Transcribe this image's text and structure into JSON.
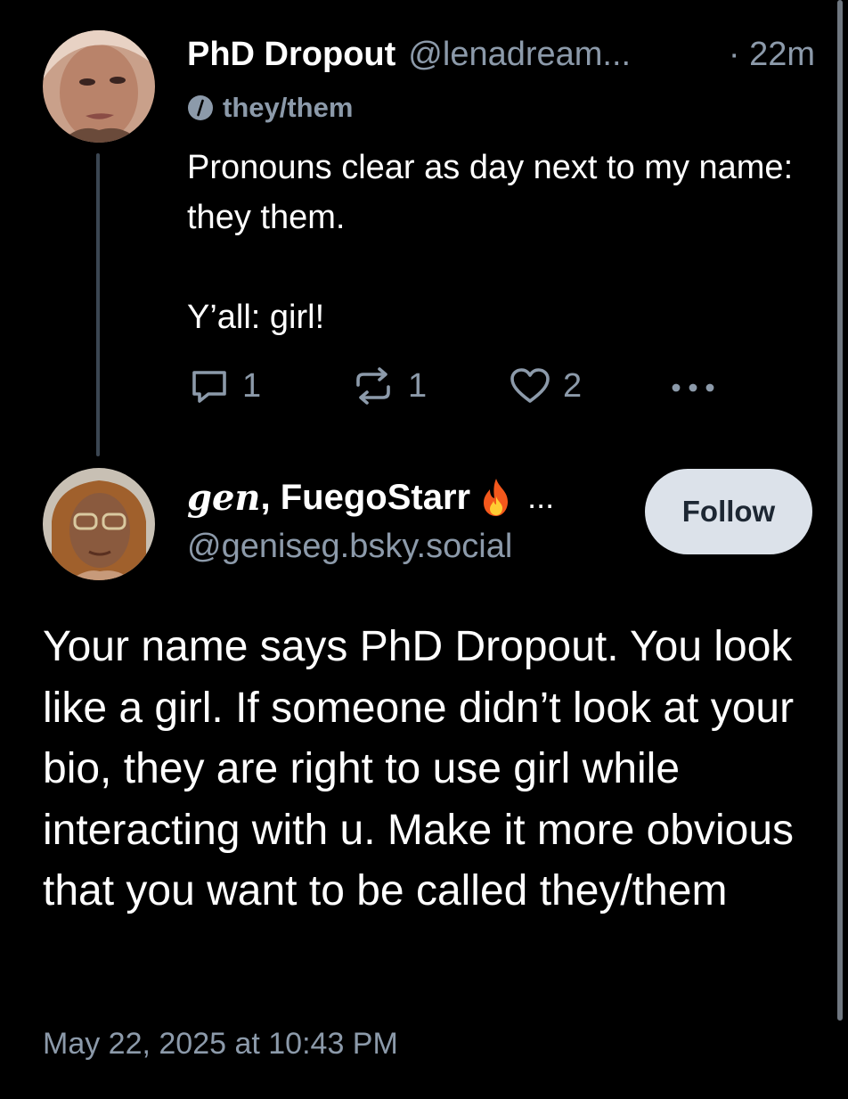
{
  "parent_post": {
    "display_name": "PhD Dropout",
    "handle": "@lenadream...",
    "time": "· 22m",
    "pronouns": "they/them",
    "text_line1": "Pronouns clear as day next to my name: they them.",
    "text_line2": "Y’all: girl!",
    "reply_count": "1",
    "repost_count": "1",
    "like_count": "2",
    "more_icon": "ellipsis-icon"
  },
  "reply_post": {
    "display_name_italic": "gen",
    "display_name_rest": ", FuegoStarr",
    "name_emoji": "fire-emoji",
    "name_ellipsis": "...",
    "handle": "@geniseg.bsky.social",
    "follow_label": "Follow",
    "text": "Your name says PhD Dropout. You look like a girl. If someone didn’t look at your bio, they are right to use girl while interacting with u. Make it more obvious that you want to be called they/them",
    "timestamp": "May 22, 2025 at 10:43 PM"
  },
  "colors": {
    "background": "#000000",
    "muted_text": "#8c9aaa",
    "follow_button_bg": "#dce2ea",
    "thread_line": "#3b4652"
  }
}
